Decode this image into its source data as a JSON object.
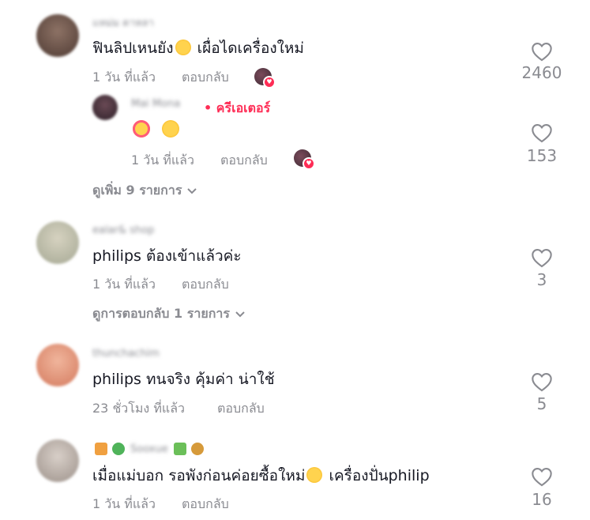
{
  "comments": [
    {
      "username": "แหม่ม ดาหลา",
      "text": "ฟินลิปเหนยัง",
      "text_after_emoji": " เผื่อไดเครื่องใหม่",
      "emoji": "rolling-laughing-emoji",
      "time": "1 วัน ที่แล้ว",
      "reply": "ตอบกลับ",
      "likes": "2460"
    },
    {
      "username": "Mai Mona",
      "creator_tag": "• ครีเอเตอร์",
      "emojis": [
        "smiling-hearts-emoji",
        "grinning-sweat-emoji"
      ],
      "time": "1 วัน ที่แล้ว",
      "reply": "ตอบกลับ",
      "likes": "153"
    },
    {
      "username": "ealar& shop",
      "text": "philips ต้องเข้าแล้วค่ะ",
      "time": "1 วัน ที่แล้ว",
      "reply": "ตอบกลับ",
      "likes": "3"
    },
    {
      "username": "thunchachim",
      "text": "philips ทนจริง คุ้มค่า น่าใช้",
      "time": "23 ชั่วโมง ที่แล้ว",
      "reply": "ตอบกลับ",
      "likes": "5"
    },
    {
      "username": "Sooxue",
      "text": "เมื่อแม่บอก รอพังก่อนค่อยซื้อใหม่",
      "text_after_emoji": " เครื่องปั่นphilip",
      "emoji": "squinting-tongue-emoji",
      "time": "1 วัน ที่แล้ว",
      "reply": "ตอบกลับ",
      "likes": "16"
    }
  ],
  "view_more_1": "ดูเพิ่ม 9 รายการ",
  "view_more_2": "ดูการตอบกลับ 1 รายการ",
  "colors": {
    "accent": "#fe2c55",
    "muted": "#8a8b91",
    "text": "#161823"
  }
}
